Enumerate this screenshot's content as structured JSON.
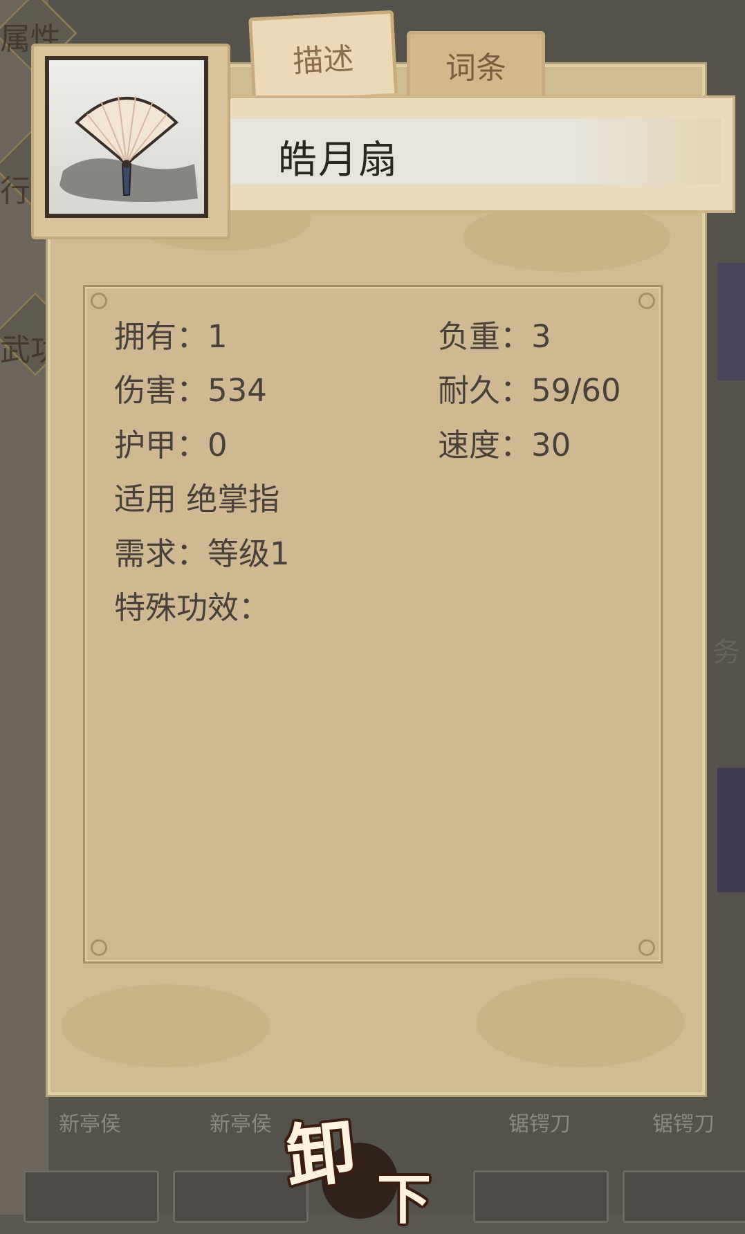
{
  "tabs": {
    "describe": "描述",
    "entries": "词条"
  },
  "item": {
    "name": "皓月扇",
    "icon": "folding-fan-icon"
  },
  "stats": {
    "owned": "拥有：1",
    "weight": "负重：3",
    "damage": "伤害：534",
    "durability": "耐久：59/60",
    "armor": "护甲：0",
    "speed": "速度：30",
    "applicable": "适用 绝掌指",
    "requirement": "需求：等级1",
    "special": "特殊功效："
  },
  "background": {
    "item_labels": [
      "新亭侯",
      "新亭侯",
      "锯锷刀",
      "锯锷刀"
    ],
    "side_text": [
      "属性",
      "行囊",
      "武功"
    ],
    "right_text": "务"
  },
  "button": {
    "unequip_1": "卸",
    "unequip_2": "下"
  },
  "colors": {
    "panel": "#cfba91",
    "text": "#4a4038",
    "button_text": "#fff3e0"
  }
}
